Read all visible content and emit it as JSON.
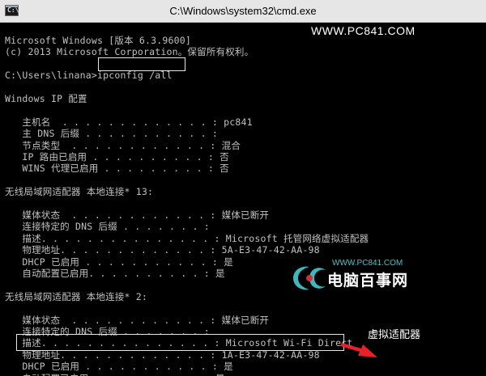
{
  "window": {
    "title": "C:\\Windows\\system32\\cmd.exe",
    "icon": "cmd-icon",
    "icon_prompt": "C:\\"
  },
  "console": {
    "lines": [
      "Microsoft Windows [版本 6.3.9600]",
      "(c) 2013 Microsoft Corporation。保留所有权利。",
      "",
      "C:\\Users\\linana>ipconfig /all",
      "",
      "Windows IP 配置",
      "",
      "   主机名  . . . . . . . . . . . . . : pc841",
      "   主 DNS 后缀 . . . . . . . . . . . :",
      "   节点类型  . . . . . . . . . . . . : 混合",
      "   IP 路由已启用 . . . . . . . . . . : 否",
      "   WINS 代理已启用 . . . . . . . . . : 否",
      "",
      "无线局域网适配器 本地连接* 13:",
      "",
      "   媒体状态  . . . . . . . . . . . . : 媒体已断开",
      "   连接特定的 DNS 后缀 . . . . . . . :",
      "   描述. . . . . . . . . . . . . . . : Microsoft 托管网络虚拟适配器",
      "   物理地址. . . . . . . . . . . . . : 5A-E3-47-42-AA-98",
      "   DHCP 已启用 . . . . . . . . . . . : 是",
      "   自动配置已启用. . . . . . . . . . : 是",
      "",
      "无线局域网适配器 本地连接* 2:",
      "",
      "   媒体状态  . . . . . . . . . . . . : 媒体已断开",
      "   连接特定的 DNS 后缀 . . . . . . . :",
      "   描述. . . . . . . . . . . . . . . : Microsoft Wi-Fi Direct",
      "   物理地址. . . . . . . . . . . . . : 1A-E3-47-42-AA-98",
      "   DHCP 已启用 . . . . . . . . . . . : 是",
      "   自动配置已启用. . . . . . . . . . : 是"
    ],
    "wifi_direct_suffix": "虚拟适配器"
  },
  "watermark": {
    "top_url": "WWW.PC841.COM",
    "logo_url": "WWW.PC841.COM",
    "logo_name": "电脑百事网"
  },
  "colors": {
    "console_bg": "#000000",
    "console_text": "#c0c0c0",
    "arrow": "#e8202a",
    "logo_teal": "#3fb6bd",
    "logo_red": "#c8323a"
  }
}
